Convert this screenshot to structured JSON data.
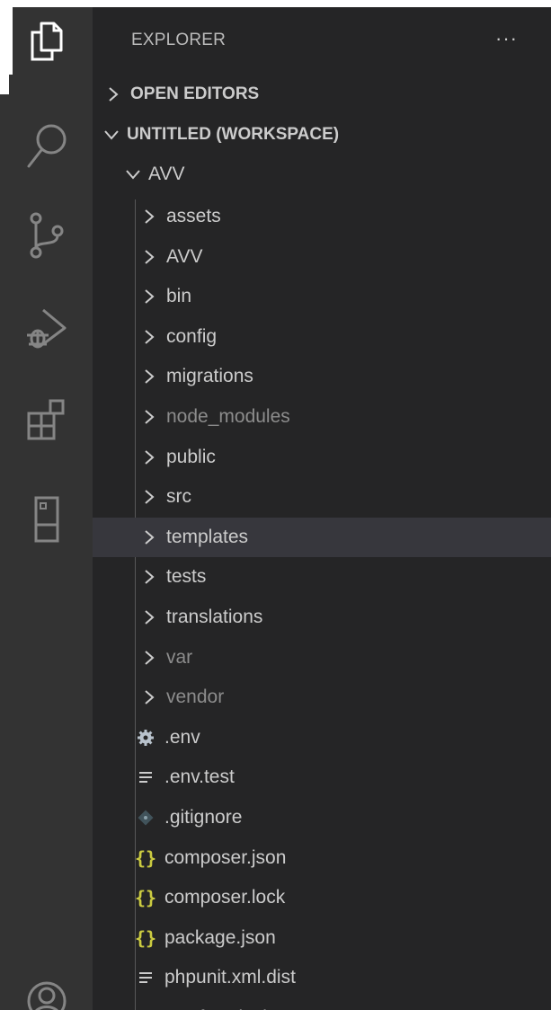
{
  "explorer": {
    "title": "EXPLORER",
    "more_actions": "···"
  },
  "sections": {
    "open_editors": "OPEN EDITORS",
    "workspace": "UNTITLED (WORKSPACE)"
  },
  "root_folder": "AVV",
  "folders": [
    {
      "label": "assets",
      "dimmed": false
    },
    {
      "label": "AVV",
      "dimmed": false
    },
    {
      "label": "bin",
      "dimmed": false
    },
    {
      "label": "config",
      "dimmed": false
    },
    {
      "label": "migrations",
      "dimmed": false
    },
    {
      "label": "node_modules",
      "dimmed": true
    },
    {
      "label": "public",
      "dimmed": false
    },
    {
      "label": "src",
      "dimmed": false
    },
    {
      "label": "templates",
      "dimmed": false,
      "selected": true
    },
    {
      "label": "tests",
      "dimmed": false
    },
    {
      "label": "translations",
      "dimmed": false
    },
    {
      "label": "var",
      "dimmed": true
    },
    {
      "label": "vendor",
      "dimmed": true
    }
  ],
  "files": [
    {
      "label": ".env",
      "icon": "gear-icon"
    },
    {
      "label": ".env.test",
      "icon": "lines-icon"
    },
    {
      "label": ".gitignore",
      "icon": "git-icon"
    },
    {
      "label": "composer.json",
      "icon": "json-icon"
    },
    {
      "label": "composer.lock",
      "icon": "json-icon"
    },
    {
      "label": "package.json",
      "icon": "json-icon"
    },
    {
      "label": "phpunit.xml.dist",
      "icon": "lines-icon"
    },
    {
      "label": "symfony.lock",
      "icon": "lines-icon"
    }
  ],
  "activity_bar": [
    "explorer-icon",
    "search-icon",
    "source-control-icon",
    "run-debug-icon",
    "extensions-icon",
    "remote-explorer-icon",
    "account-icon"
  ],
  "colors": {
    "sidebar_bg": "#252526",
    "activity_bg": "#333333",
    "selected_row": "#37373d",
    "json_yellow": "#cbcb41"
  }
}
